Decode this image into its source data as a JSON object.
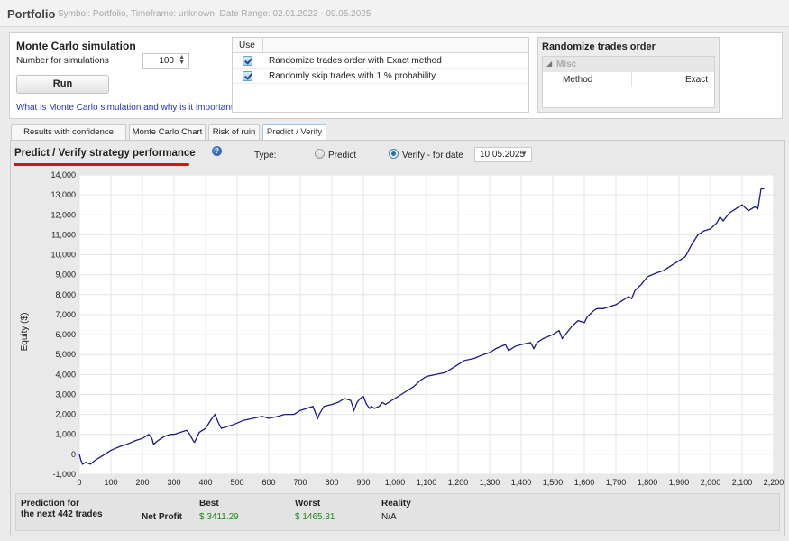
{
  "window": {
    "title": "Portfolio",
    "subtitle": "Symbol: Portfolio, Timeframe: unknown, Date Range: 02.01.2023 - 09.05.2025"
  },
  "monte_carlo": {
    "title": "Monte Carlo simulation",
    "num_label": "Number for simulations",
    "num_value": "100",
    "run_label": "Run",
    "help_link": "What is Monte Carlo simulation and why is it important?",
    "use_header": "Use",
    "options": [
      {
        "label": "Randomize trades order with Exact method",
        "checked": true
      },
      {
        "label": "Randomly skip trades with 1 % probability",
        "checked": true
      }
    ]
  },
  "randomize_panel": {
    "title": "Randomize trades order",
    "group": "Misc",
    "method_key": "Method",
    "method_value": "Exact"
  },
  "tabs": [
    {
      "label": "Results with confidence levels",
      "active": false
    },
    {
      "label": "Monte Carlo Chart",
      "active": false
    },
    {
      "label": "Risk of ruin",
      "active": false
    },
    {
      "label": "Predict / Verify",
      "active": true
    }
  ],
  "predict": {
    "title": "Predict / Verify strategy performance",
    "type_label": "Type:",
    "predict_label": "Predict",
    "verify_label": "Verify - for date",
    "selected": "verify",
    "date_value": "10.05.2025"
  },
  "summary": {
    "prediction_line1": "Prediction for",
    "prediction_line2": "the next 442 trades",
    "best_header": "Best",
    "worst_header": "Worst",
    "reality_header": "Reality",
    "net_profit_label": "Net Profit",
    "best_value": "$ 3411.29",
    "worst_value": "$ 1465.31",
    "reality_value": "N/A"
  },
  "chart_data": {
    "type": "line",
    "title": "",
    "xlabel": "",
    "ylabel": "Equity ($)",
    "xlim": [
      0,
      2200
    ],
    "ylim": [
      -1000,
      14000
    ],
    "x_ticks": [
      0,
      100,
      200,
      300,
      400,
      500,
      600,
      700,
      800,
      900,
      1000,
      1100,
      1200,
      1300,
      1400,
      1500,
      1600,
      1700,
      1800,
      1900,
      2000,
      2100,
      2200
    ],
    "x_tick_labels": [
      "0",
      "100",
      "200",
      "300",
      "400",
      "500",
      "600",
      "700",
      "800",
      "900",
      "1,000",
      "1,100",
      "1,200",
      "1,300",
      "1,400",
      "1,500",
      "1,600",
      "1,700",
      "1,800",
      "1,900",
      "2,000",
      "2,100",
      "2,200"
    ],
    "y_ticks": [
      -1000,
      0,
      1000,
      2000,
      3000,
      4000,
      5000,
      6000,
      7000,
      8000,
      9000,
      10000,
      11000,
      12000,
      13000,
      14000
    ],
    "y_tick_labels": [
      "-1,000",
      "0",
      "1,000",
      "2,000",
      "3,000",
      "4,000",
      "5,000",
      "6,000",
      "7,000",
      "8,000",
      "9,000",
      "10,000",
      "11,000",
      "12,000",
      "13,000",
      "14,000"
    ],
    "grid": true,
    "line_color": "#1a1a8c",
    "series": [
      {
        "x": [
          0,
          5,
          10,
          20,
          35,
          50,
          60,
          80,
          100,
          130,
          150,
          180,
          200,
          220,
          230,
          235,
          250,
          270,
          290,
          300,
          320,
          340,
          350,
          360,
          365,
          380,
          400,
          420,
          430,
          440,
          450,
          470,
          490,
          520,
          550,
          580,
          600,
          630,
          650,
          680,
          700,
          720,
          740,
          755,
          760,
          775,
          800,
          820,
          840,
          860,
          870,
          880,
          890,
          900,
          910,
          920,
          925,
          935,
          950,
          960,
          970,
          990,
          1000,
          1020,
          1040,
          1060,
          1080,
          1100,
          1130,
          1160,
          1180,
          1200,
          1220,
          1250,
          1280,
          1300,
          1320,
          1350,
          1360,
          1380,
          1400,
          1430,
          1440,
          1450,
          1470,
          1500,
          1520,
          1530,
          1560,
          1580,
          1600,
          1610,
          1630,
          1640,
          1660,
          1700,
          1720,
          1740,
          1750,
          1760,
          1780,
          1800,
          1830,
          1850,
          1880,
          1900,
          1920,
          1940,
          1960,
          1980,
          2000,
          2020,
          2030,
          2040,
          2060,
          2080,
          2090,
          2100,
          2120,
          2130,
          2140,
          2150,
          2160,
          2170
        ],
        "y": [
          0,
          -300,
          -500,
          -400,
          -500,
          -300,
          -200,
          0,
          200,
          400,
          500,
          700,
          800,
          1000,
          800,
          500,
          700,
          900,
          1000,
          1000,
          1100,
          1200,
          1000,
          700,
          600,
          1100,
          1300,
          1800,
          2000,
          1600,
          1300,
          1400,
          1500,
          1700,
          1800,
          1900,
          1800,
          1900,
          2000,
          2000,
          2200,
          2300,
          2400,
          1800,
          2000,
          2400,
          2500,
          2600,
          2800,
          2700,
          2200,
          2600,
          2800,
          2900,
          2500,
          2300,
          2400,
          2300,
          2400,
          2600,
          2500,
          2700,
          2800,
          3000,
          3200,
          3400,
          3700,
          3900,
          4000,
          4100,
          4300,
          4500,
          4700,
          4800,
          5000,
          5100,
          5300,
          5500,
          5200,
          5400,
          5500,
          5600,
          5300,
          5600,
          5800,
          6000,
          6200,
          5800,
          6400,
          6700,
          6600,
          6900,
          7200,
          7300,
          7300,
          7500,
          7700,
          7900,
          7800,
          8200,
          8500,
          8900,
          9100,
          9200,
          9500,
          9700,
          9900,
          10500,
          11000,
          11200,
          11300,
          11600,
          11900,
          11700,
          12100,
          12300,
          12400,
          12500,
          12200,
          12300,
          12400,
          12300,
          13300,
          13300
        ]
      }
    ]
  }
}
